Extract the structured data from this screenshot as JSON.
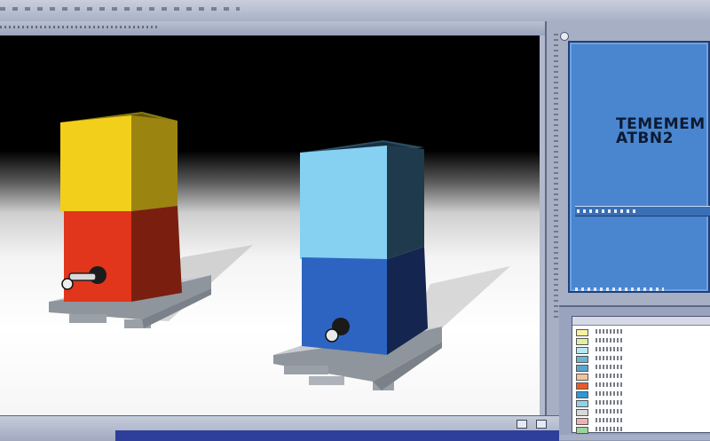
{
  "info_panel": {
    "title_line1": "TEMEMEM",
    "title_line2": "ATBN2"
  },
  "scene": {
    "background_top": "#000000",
    "floor": "#f4f4f4",
    "left_tank_colors": {
      "top_section": "#f2cf1a",
      "bottom_section": "#e1351c"
    },
    "right_tank_colors": {
      "top_section": "#86d0f2",
      "bottom_section": "#2d64c1"
    }
  },
  "list_panel": {
    "swatch_colors": [
      "#f7f2a0",
      "#dff0a0",
      "#b9e8f2",
      "#6bb6d6",
      "#5aa5cf",
      "#f2c3a0",
      "#e85a2a",
      "#2a9ad6",
      "#8fd2ee",
      "#d8d8d8",
      "#f2b0b0",
      "#9bd59b"
    ]
  },
  "taskbar": {
    "accent": "#2d3f9a"
  }
}
